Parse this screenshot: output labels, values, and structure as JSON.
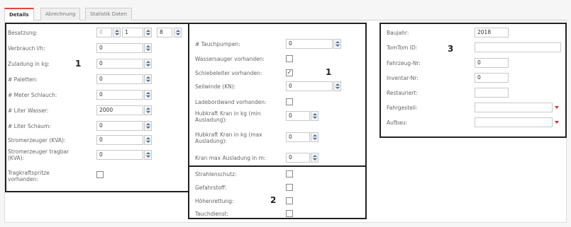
{
  "tabs": [
    {
      "label": "Details",
      "active": true
    },
    {
      "label": "Abrechnung",
      "active": false
    },
    {
      "label": "Statistik Daten",
      "active": false
    }
  ],
  "accent_color": "#e2453c",
  "left": {
    "number": "1",
    "besatzung": {
      "label": "Besatzung:",
      "v1": "0",
      "v2": "1",
      "v3": "8"
    },
    "fields": [
      {
        "label": "Verbrauch l/h:",
        "value": "0"
      },
      {
        "label": "Zuladung in kg:",
        "value": "0"
      },
      {
        "label": "# Paletten:",
        "value": "0"
      },
      {
        "label": "# Meter Schlauch:",
        "value": "0"
      },
      {
        "label": "# Liter Wasser:",
        "value": "2000"
      },
      {
        "label": "# Liter Schaum:",
        "value": "0"
      },
      {
        "label": "Stromerzeuger (KVA):",
        "value": "0"
      },
      {
        "label": "Stromerzeuger tragbar (KVA):",
        "value": "0"
      }
    ],
    "tragkraftspritze": {
      "label": "Tragkraftspritze vorhanden:",
      "checked": false
    }
  },
  "middle": {
    "number": "1",
    "rows": [
      {
        "label": "# Tauchpumpen:",
        "type": "number",
        "value": "0"
      },
      {
        "label": "Wassersauger vorhanden:",
        "type": "check",
        "checked": false
      },
      {
        "label": "Schiebeleiter vorhanden:",
        "type": "check",
        "checked": true
      },
      {
        "label": "Seilwinde (KN):",
        "type": "number",
        "value": "0"
      },
      {
        "label": "Ladebordwand vorhanden:",
        "type": "check",
        "checked": false
      },
      {
        "label": "Hubkraft Kran in kg (min Ausladung):",
        "type": "number",
        "value": "0"
      },
      {
        "label": "Hubkraft Kran in kg (max Ausladung):",
        "type": "number",
        "value": "0"
      },
      {
        "label": "Kran max Ausladung in m:",
        "type": "number",
        "value": "0"
      }
    ]
  },
  "lower": {
    "number": "2",
    "rows": [
      {
        "label": "Strahlenschutz:",
        "checked": false
      },
      {
        "label": "Gefahrstoff:",
        "checked": false
      },
      {
        "label": "Höhenrettung:",
        "checked": false
      },
      {
        "label": "Tauchdienst:",
        "checked": false
      }
    ]
  },
  "right": {
    "number": "3",
    "rows": [
      {
        "label": "Baujahr:",
        "type": "text",
        "value": "2018"
      },
      {
        "label": "TomTom ID:",
        "type": "wide",
        "value": ""
      },
      {
        "label": "Fahrzeug-Nr:",
        "type": "text",
        "value": "0"
      },
      {
        "label": "Inventar-Nr:",
        "type": "text",
        "value": "0"
      },
      {
        "label": "Restauriert:",
        "type": "text",
        "value": ""
      },
      {
        "label": "Fahrgestell:",
        "type": "select",
        "value": ""
      },
      {
        "label": "Aufbau:",
        "type": "select",
        "value": ""
      }
    ]
  }
}
